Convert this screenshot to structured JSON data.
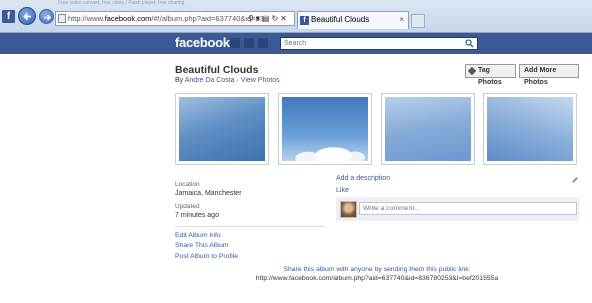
{
  "browser": {
    "address_prefix": "http://www.",
    "address_domain": "facebook.com",
    "address_rest": "/#!/album.php?aid=637740&id=83",
    "tab_title": "Beautiful Clouds",
    "tab_close": "×",
    "inactive_tab_text": "Free video convert, free video / Flash player, free sharing"
  },
  "fb": {
    "logo": "facebook",
    "search_placeholder": "Search"
  },
  "album": {
    "title": "Beautiful Clouds",
    "by_prefix": "By",
    "author": "Andre Da Costa",
    "separator": "·",
    "view_photos": "View Photos",
    "tag_button": "Tag Photos",
    "add_button": "Add More Photos"
  },
  "meta": {
    "location_label": "Location",
    "location_value": "Jamaica, Manchester",
    "updated_label": "Updated",
    "updated_value": "7 minutes ago"
  },
  "side_links": [
    "Edit Album Info",
    "Share This Album",
    "Post Album to Profile"
  ],
  "actions": {
    "add_description": "Add a description",
    "like": "Like",
    "comment_placeholder": "Write a comment..."
  },
  "share": {
    "text": "Share this album with anyone by sending them this public link:",
    "url": "http://www.facebook.com/album.php?aid=637740&id=836780253&l=bef201555a"
  },
  "colors": {
    "fb_blue": "#3b5998",
    "link": "#3b5998"
  }
}
